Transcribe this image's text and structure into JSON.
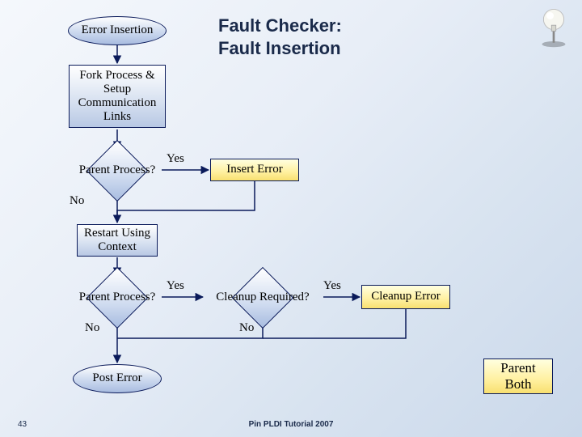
{
  "title_line1": "Fault Checker:",
  "title_line2": "Fault Insertion",
  "nodes": {
    "error_insertion": "Error Insertion",
    "fork_setup": "Fork Process &\nSetup\nCommunication\nLinks",
    "parent1": "Parent Process?",
    "insert_error": "Insert Error",
    "restart": "Restart Using\nContext",
    "parent2": "Parent Process?",
    "cleanup_req": "Cleanup Required?",
    "cleanup_err": "Cleanup Error",
    "post_error": "Post Error",
    "parent_both": "Parent\nBoth"
  },
  "labels": {
    "yes1": "Yes",
    "no1": "No",
    "yes2": "Yes",
    "no2": "No",
    "yes3": "Yes",
    "no3": "No"
  },
  "footer": "Pin PLDI Tutorial 2007",
  "slide_number": "43",
  "chart_data": {
    "type": "flowchart",
    "title": "Fault Checker: Fault Insertion",
    "nodes": [
      {
        "id": "start",
        "shape": "terminator",
        "label": "Error Insertion"
      },
      {
        "id": "fork",
        "shape": "process",
        "label": "Fork Process & Setup Communication Links"
      },
      {
        "id": "d1",
        "shape": "decision",
        "label": "Parent Process?"
      },
      {
        "id": "ins",
        "shape": "process",
        "label": "Insert Error",
        "style": "highlight"
      },
      {
        "id": "restart",
        "shape": "process",
        "label": "Restart Using Context"
      },
      {
        "id": "d2",
        "shape": "decision",
        "label": "Parent Process?"
      },
      {
        "id": "d3",
        "shape": "decision",
        "label": "Cleanup Required?"
      },
      {
        "id": "clean",
        "shape": "process",
        "label": "Cleanup Error",
        "style": "highlight"
      },
      {
        "id": "post",
        "shape": "terminator",
        "label": "Post Error"
      },
      {
        "id": "legend",
        "shape": "process",
        "label": "Parent Both",
        "style": "highlight"
      }
    ],
    "edges": [
      {
        "from": "start",
        "to": "fork"
      },
      {
        "from": "fork",
        "to": "d1"
      },
      {
        "from": "d1",
        "to": "ins",
        "label": "Yes"
      },
      {
        "from": "d1",
        "to": "restart",
        "label": "No"
      },
      {
        "from": "ins",
        "to": "restart"
      },
      {
        "from": "restart",
        "to": "d2"
      },
      {
        "from": "d2",
        "to": "d3",
        "label": "Yes"
      },
      {
        "from": "d2",
        "to": "post",
        "label": "No"
      },
      {
        "from": "d3",
        "to": "clean",
        "label": "Yes"
      },
      {
        "from": "d3",
        "to": "post",
        "label": "No"
      },
      {
        "from": "clean",
        "to": "post"
      }
    ]
  }
}
